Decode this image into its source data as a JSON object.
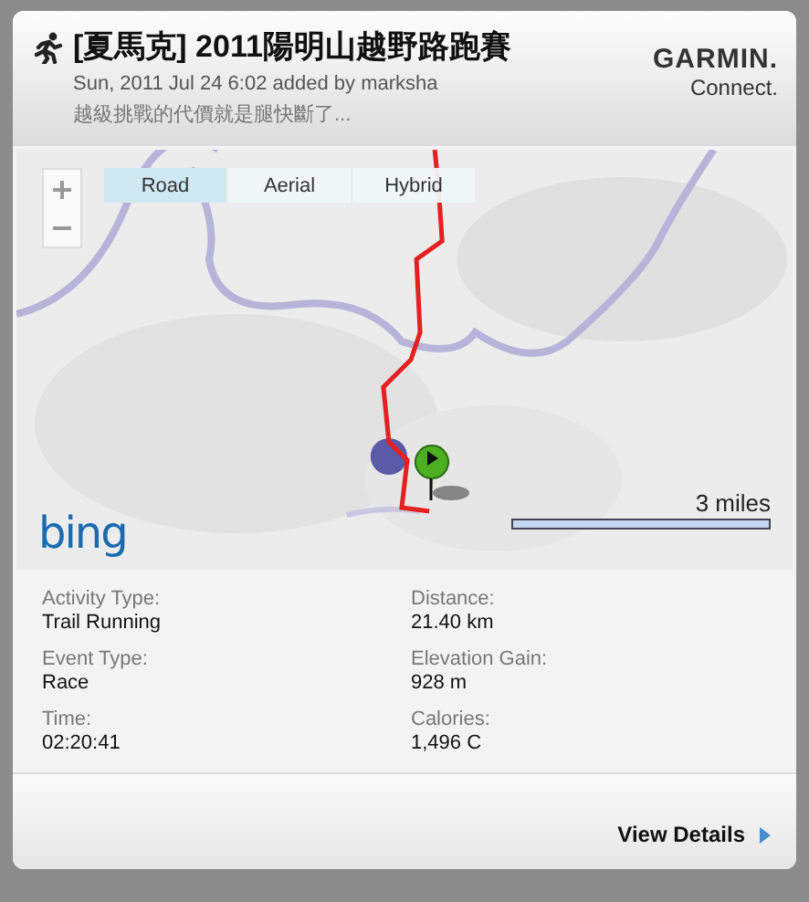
{
  "header": {
    "title": "[夏馬克] 2011陽明山越野路跑賽",
    "meta": "Sun, 2011 Jul 24 6:02 added by marksha",
    "description": "越級挑戰的代價就是腿快斷了...",
    "brand": "GARMIN.",
    "brand_sub": "Connect."
  },
  "map": {
    "view_tabs": [
      {
        "label": "Road",
        "selected": true
      },
      {
        "label": "Aerial",
        "selected": false
      },
      {
        "label": "Hybrid",
        "selected": false
      }
    ],
    "scale": "3 miles",
    "provider": "bing"
  },
  "stats": [
    {
      "label": "Activity Type:",
      "value": "Trail Running"
    },
    {
      "label": "Distance:",
      "value": "21.40 km"
    },
    {
      "label": "Event Type:",
      "value": "Race"
    },
    {
      "label": "Elevation Gain:",
      "value": "928 m"
    },
    {
      "label": "Time:",
      "value": "02:20:41"
    },
    {
      "label": "Calories:",
      "value": "1,496 C"
    }
  ],
  "footer": {
    "link": "View Details"
  }
}
